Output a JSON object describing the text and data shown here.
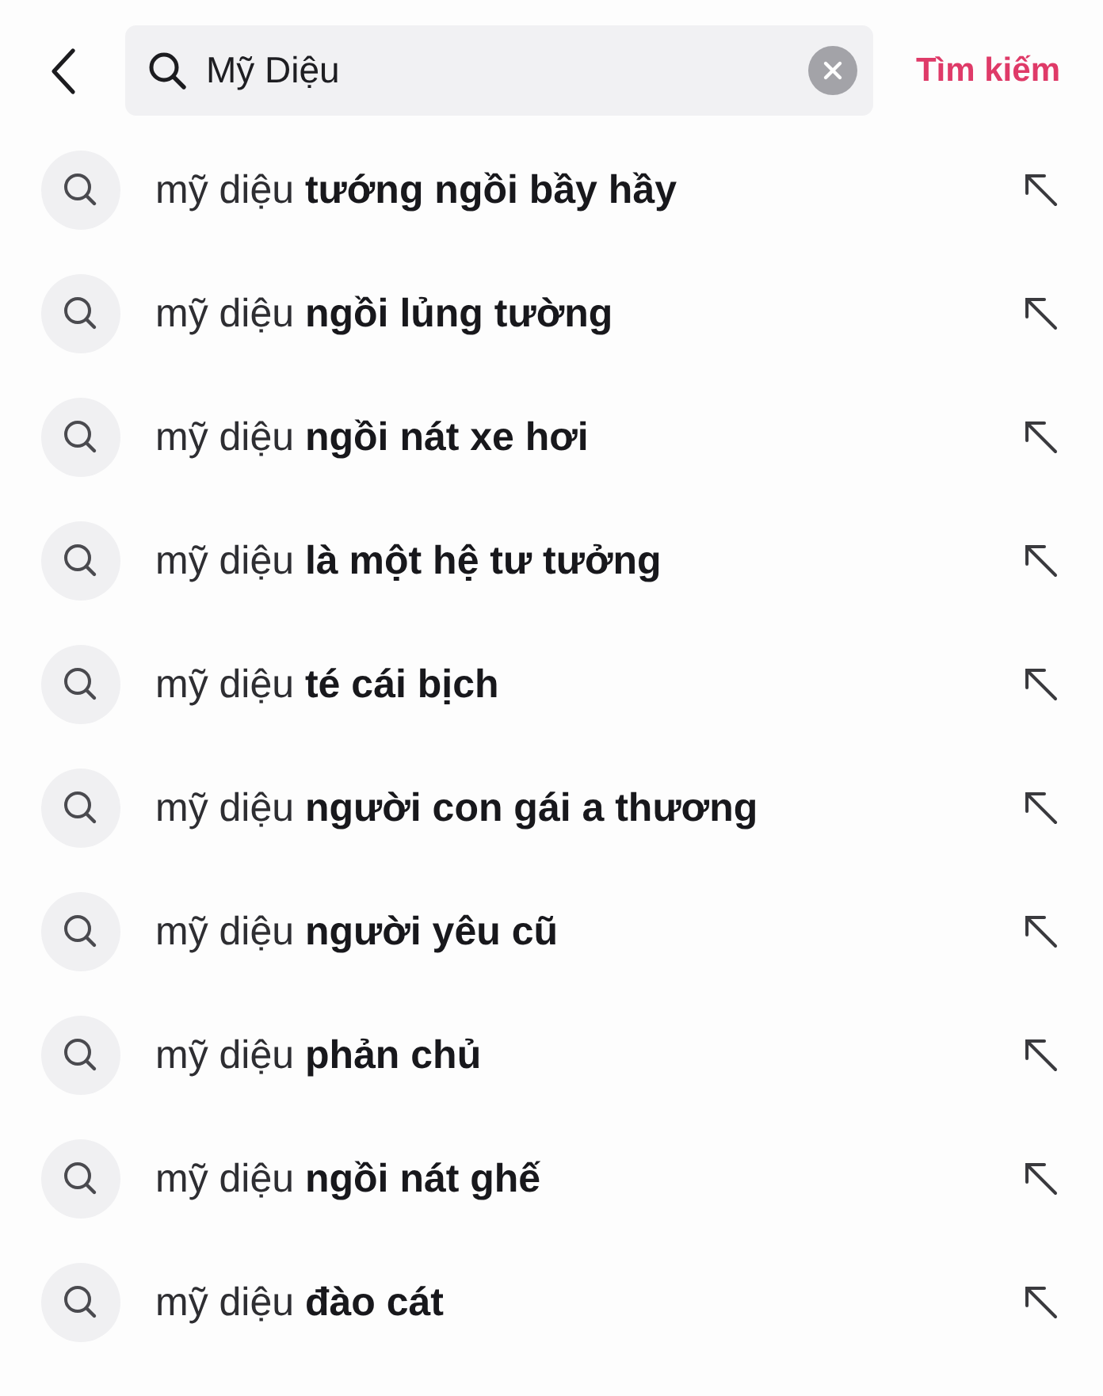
{
  "search_bar": {
    "value": "Mỹ Diệu",
    "action": "Tìm kiếm"
  },
  "suggestions": [
    {
      "text": "mỹ diệu **tướng ngồi bầy hầy**"
    },
    {
      "text": "mỹ diệu **ngồi lủng tường**"
    },
    {
      "text": "mỹ diệu **ngồi nát xe hơi**"
    },
    {
      "text": "mỹ diệu **là một hệ tư tưởng**"
    },
    {
      "text": "mỹ diệu **té cái bịch**"
    },
    {
      "text": "mỹ diệu **người con gái a thương**"
    },
    {
      "text": "mỹ diệu **người yêu cũ**"
    },
    {
      "text": "mỹ diệu **phản chủ**"
    },
    {
      "text": "mỹ diệu **ngồi nát ghế**"
    },
    {
      "text": "mỹ diệu **đào cát**"
    }
  ]
}
